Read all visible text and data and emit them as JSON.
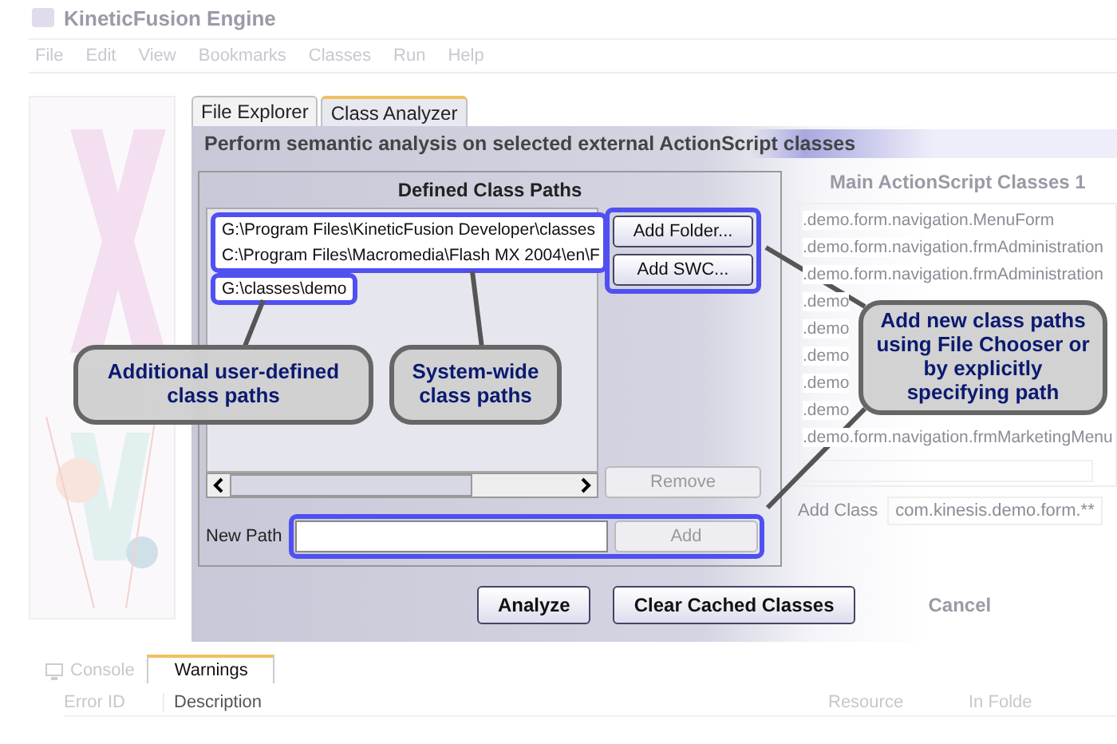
{
  "window": {
    "title": "KineticFusion Engine"
  },
  "menu": [
    "File",
    "Edit",
    "View",
    "Bookmarks",
    "Classes",
    "Run",
    "Help"
  ],
  "tabs": [
    {
      "label": "File Explorer",
      "selected": false
    },
    {
      "label": "Class Analyzer",
      "selected": true
    }
  ],
  "panel": {
    "heading": "Perform semantic analysis on selected external ActionScript classes",
    "defined_paths": {
      "title": "Defined Class Paths",
      "system_paths": [
        "G:\\Program Files\\KineticFusion Developer\\classes",
        "C:\\Program Files\\Macromedia\\Flash MX 2004\\en\\F"
      ],
      "user_paths": [
        "G:\\classes\\demo"
      ],
      "buttons": [
        {
          "label": "Add Folder...",
          "disabled": false
        },
        {
          "label": "Add SWC...",
          "disabled": false
        }
      ],
      "remove_button": {
        "label": "Remove",
        "disabled": true
      },
      "new_path": {
        "label": "New Path",
        "add_button": {
          "label": "Add",
          "disabled": true
        }
      }
    },
    "main_classes": {
      "title": "Main ActionScript Classes 1",
      "items": [
        ".demo.form.navigation.MenuForm",
        ".demo.form.navigation.frmAdministration",
        ".demo.form.navigation.frmAdministration",
        ".demo",
        ".demo",
        ".demo",
        ".demo",
        ".demo",
        ".demo.form.navigation.frmMarketingMenu"
      ],
      "add_class": {
        "label": "Add Class",
        "value": "com.kinesis.demo.form.**"
      }
    },
    "actions": [
      {
        "label": "Analyze",
        "disabled": false
      },
      {
        "label": "Clear Cached Classes",
        "disabled": false
      },
      {
        "label": "Cancel",
        "disabled": true
      }
    ]
  },
  "bottom_tabs": [
    {
      "label": "Console",
      "selected": false
    },
    {
      "label": "Warnings",
      "selected": true
    }
  ],
  "columns": [
    "Error ID",
    "Description",
    "Resource",
    "In Folde"
  ],
  "callouts": [
    {
      "text": "Additional user-defined class paths"
    },
    {
      "text": "System-wide class paths"
    },
    {
      "text": "Add new class paths using File Chooser or by explicitly specifying path"
    }
  ]
}
